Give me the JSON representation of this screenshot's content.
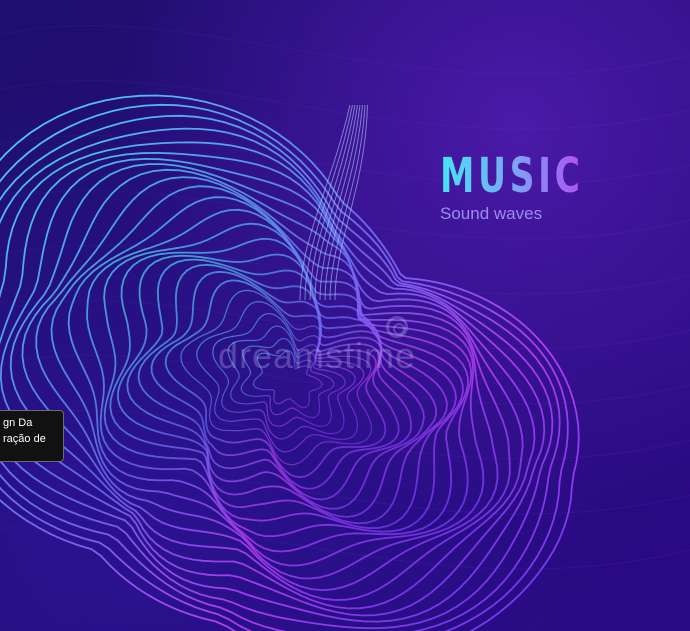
{
  "image": {
    "title": "MUSIC",
    "subtitle": "Sound waves",
    "watermark": "dreamstime",
    "colors": {
      "background": "#1e0f6e",
      "cyan": "#46e4f2",
      "violet": "#6a35f0",
      "magenta": "#c23cf2"
    }
  },
  "tooltip": {
    "lines": [
      "gn  Da",
      "ração de"
    ]
  }
}
